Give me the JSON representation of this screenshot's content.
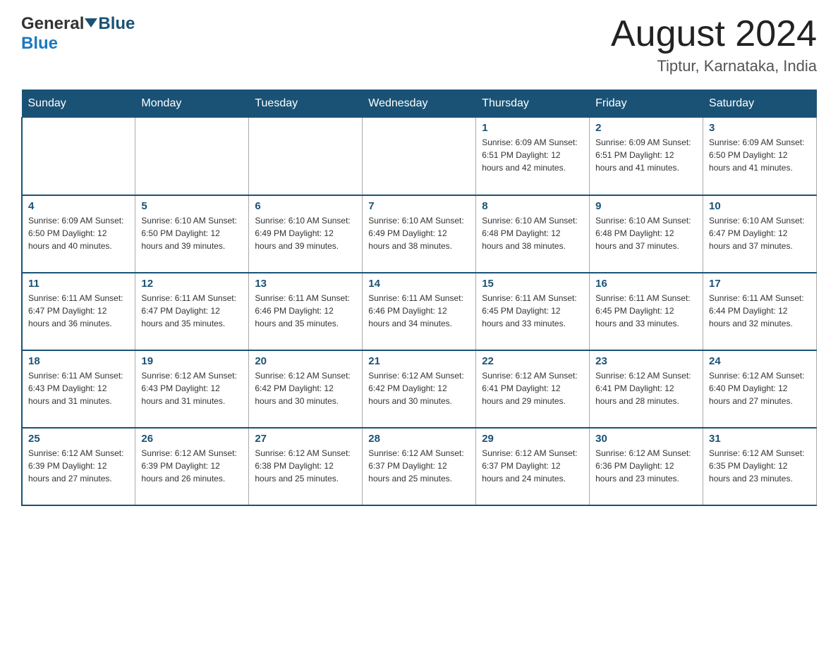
{
  "header": {
    "logo": {
      "part1": "General",
      "part2": "Blue"
    },
    "title": "August 2024",
    "location": "Tiptur, Karnataka, India"
  },
  "calendar": {
    "days_of_week": [
      "Sunday",
      "Monday",
      "Tuesday",
      "Wednesday",
      "Thursday",
      "Friday",
      "Saturday"
    ],
    "weeks": [
      [
        {
          "day": "",
          "info": ""
        },
        {
          "day": "",
          "info": ""
        },
        {
          "day": "",
          "info": ""
        },
        {
          "day": "",
          "info": ""
        },
        {
          "day": "1",
          "info": "Sunrise: 6:09 AM\nSunset: 6:51 PM\nDaylight: 12 hours\nand 42 minutes."
        },
        {
          "day": "2",
          "info": "Sunrise: 6:09 AM\nSunset: 6:51 PM\nDaylight: 12 hours\nand 41 minutes."
        },
        {
          "day": "3",
          "info": "Sunrise: 6:09 AM\nSunset: 6:50 PM\nDaylight: 12 hours\nand 41 minutes."
        }
      ],
      [
        {
          "day": "4",
          "info": "Sunrise: 6:09 AM\nSunset: 6:50 PM\nDaylight: 12 hours\nand 40 minutes."
        },
        {
          "day": "5",
          "info": "Sunrise: 6:10 AM\nSunset: 6:50 PM\nDaylight: 12 hours\nand 39 minutes."
        },
        {
          "day": "6",
          "info": "Sunrise: 6:10 AM\nSunset: 6:49 PM\nDaylight: 12 hours\nand 39 minutes."
        },
        {
          "day": "7",
          "info": "Sunrise: 6:10 AM\nSunset: 6:49 PM\nDaylight: 12 hours\nand 38 minutes."
        },
        {
          "day": "8",
          "info": "Sunrise: 6:10 AM\nSunset: 6:48 PM\nDaylight: 12 hours\nand 38 minutes."
        },
        {
          "day": "9",
          "info": "Sunrise: 6:10 AM\nSunset: 6:48 PM\nDaylight: 12 hours\nand 37 minutes."
        },
        {
          "day": "10",
          "info": "Sunrise: 6:10 AM\nSunset: 6:47 PM\nDaylight: 12 hours\nand 37 minutes."
        }
      ],
      [
        {
          "day": "11",
          "info": "Sunrise: 6:11 AM\nSunset: 6:47 PM\nDaylight: 12 hours\nand 36 minutes."
        },
        {
          "day": "12",
          "info": "Sunrise: 6:11 AM\nSunset: 6:47 PM\nDaylight: 12 hours\nand 35 minutes."
        },
        {
          "day": "13",
          "info": "Sunrise: 6:11 AM\nSunset: 6:46 PM\nDaylight: 12 hours\nand 35 minutes."
        },
        {
          "day": "14",
          "info": "Sunrise: 6:11 AM\nSunset: 6:46 PM\nDaylight: 12 hours\nand 34 minutes."
        },
        {
          "day": "15",
          "info": "Sunrise: 6:11 AM\nSunset: 6:45 PM\nDaylight: 12 hours\nand 33 minutes."
        },
        {
          "day": "16",
          "info": "Sunrise: 6:11 AM\nSunset: 6:45 PM\nDaylight: 12 hours\nand 33 minutes."
        },
        {
          "day": "17",
          "info": "Sunrise: 6:11 AM\nSunset: 6:44 PM\nDaylight: 12 hours\nand 32 minutes."
        }
      ],
      [
        {
          "day": "18",
          "info": "Sunrise: 6:11 AM\nSunset: 6:43 PM\nDaylight: 12 hours\nand 31 minutes."
        },
        {
          "day": "19",
          "info": "Sunrise: 6:12 AM\nSunset: 6:43 PM\nDaylight: 12 hours\nand 31 minutes."
        },
        {
          "day": "20",
          "info": "Sunrise: 6:12 AM\nSunset: 6:42 PM\nDaylight: 12 hours\nand 30 minutes."
        },
        {
          "day": "21",
          "info": "Sunrise: 6:12 AM\nSunset: 6:42 PM\nDaylight: 12 hours\nand 30 minutes."
        },
        {
          "day": "22",
          "info": "Sunrise: 6:12 AM\nSunset: 6:41 PM\nDaylight: 12 hours\nand 29 minutes."
        },
        {
          "day": "23",
          "info": "Sunrise: 6:12 AM\nSunset: 6:41 PM\nDaylight: 12 hours\nand 28 minutes."
        },
        {
          "day": "24",
          "info": "Sunrise: 6:12 AM\nSunset: 6:40 PM\nDaylight: 12 hours\nand 27 minutes."
        }
      ],
      [
        {
          "day": "25",
          "info": "Sunrise: 6:12 AM\nSunset: 6:39 PM\nDaylight: 12 hours\nand 27 minutes."
        },
        {
          "day": "26",
          "info": "Sunrise: 6:12 AM\nSunset: 6:39 PM\nDaylight: 12 hours\nand 26 minutes."
        },
        {
          "day": "27",
          "info": "Sunrise: 6:12 AM\nSunset: 6:38 PM\nDaylight: 12 hours\nand 25 minutes."
        },
        {
          "day": "28",
          "info": "Sunrise: 6:12 AM\nSunset: 6:37 PM\nDaylight: 12 hours\nand 25 minutes."
        },
        {
          "day": "29",
          "info": "Sunrise: 6:12 AM\nSunset: 6:37 PM\nDaylight: 12 hours\nand 24 minutes."
        },
        {
          "day": "30",
          "info": "Sunrise: 6:12 AM\nSunset: 6:36 PM\nDaylight: 12 hours\nand 23 minutes."
        },
        {
          "day": "31",
          "info": "Sunrise: 6:12 AM\nSunset: 6:35 PM\nDaylight: 12 hours\nand 23 minutes."
        }
      ]
    ]
  }
}
